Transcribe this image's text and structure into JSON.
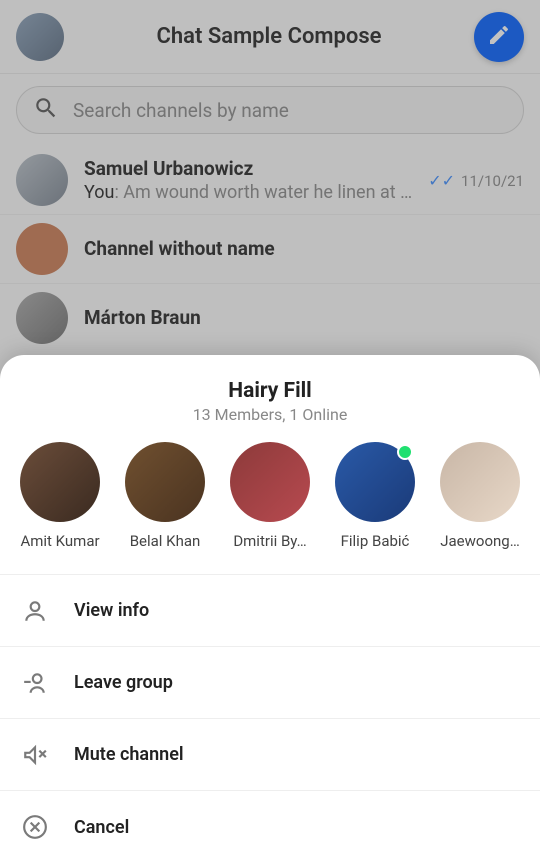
{
  "header": {
    "title": "Chat Sample Compose"
  },
  "search": {
    "placeholder": "Search channels by name"
  },
  "channels": [
    {
      "name": "Samuel Urbanowicz",
      "preview_prefix": "You",
      "preview": ": Am wound worth water he linen at ve…",
      "date": "11/10/21",
      "read": true
    },
    {
      "name": "Channel without name",
      "preview_prefix": "",
      "preview": "",
      "date": "",
      "read": false
    },
    {
      "name": "Márton Braun",
      "preview_prefix": "",
      "preview": "",
      "date": "",
      "read": false
    }
  ],
  "sheet": {
    "title": "Hairy Fill",
    "subtitle": "13 Members, 1 Online",
    "members": [
      {
        "name": "Amit Kumar",
        "online": false
      },
      {
        "name": "Belal Khan",
        "online": false
      },
      {
        "name": "Dmitrii By…",
        "online": false
      },
      {
        "name": "Filip Babić",
        "online": true
      },
      {
        "name": "Jaewoong…",
        "online": false
      }
    ],
    "actions": {
      "view_info": "View info",
      "leave_group": "Leave group",
      "mute_channel": "Mute channel",
      "cancel": "Cancel"
    }
  }
}
